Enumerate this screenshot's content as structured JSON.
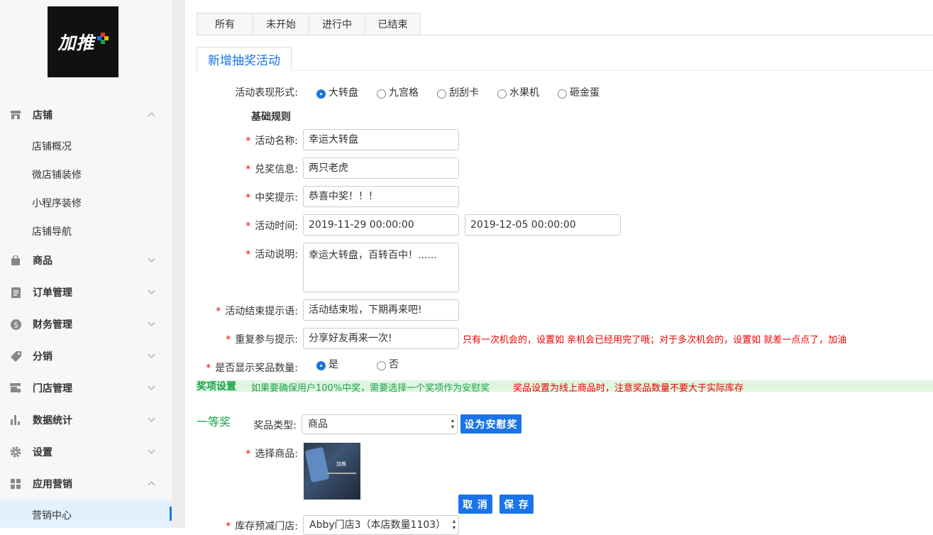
{
  "logo": {
    "text": "加推"
  },
  "sidebar": {
    "groups": [
      {
        "label": "店铺",
        "icon": "store-icon",
        "expanded": true,
        "items": [
          "店铺概况",
          "微店铺装修",
          "小程序装修",
          "店铺导航"
        ]
      },
      {
        "label": "商品",
        "icon": "bag-icon"
      },
      {
        "label": "订单管理",
        "icon": "order-icon"
      },
      {
        "label": "财务管理",
        "icon": "finance-icon"
      },
      {
        "label": "分销",
        "icon": "tag-icon"
      },
      {
        "label": "门店管理",
        "icon": "shop-settings-icon"
      },
      {
        "label": "数据统计",
        "icon": "bar-chart-icon"
      },
      {
        "label": "设置",
        "icon": "gear-icon"
      },
      {
        "label": "应用营销",
        "icon": "apps-icon",
        "expanded": true,
        "items": [
          "营销中心"
        ]
      }
    ],
    "active_item": "营销中心"
  },
  "tabs": [
    "所有",
    "未开始",
    "进行中",
    "已结束"
  ],
  "subtab": "新增抽奖活动",
  "form": {
    "style_label": "活动表现形式:",
    "styles": [
      "大转盘",
      "九宫格",
      "刮刮卡",
      "水果机",
      "砸金蛋"
    ],
    "style_selected": "大转盘",
    "section_basic": "基础规则",
    "name_label": "活动名称:",
    "name_value": "幸运大转盘",
    "prize_info_label": "兑奖信息:",
    "prize_info_value": "两只老虎",
    "win_tip_label": "中奖提示:",
    "win_tip_value": "恭喜中奖！！！",
    "time_label": "活动时间:",
    "time_start": "2019-11-29 00:00:00",
    "time_end": "2019-12-05 00:00:00",
    "desc_label": "活动说明:",
    "desc_value": "幸运大转盘，百转百中！......",
    "end_tip_label": "活动结束提示语:",
    "end_tip_value": "活动结束啦，下期再来吧!",
    "repeat_tip_label": "重复参与提示:",
    "repeat_tip_value": "分享好友再来一次!",
    "repeat_hint": "只有一次机会的，设置如 亲机会已经用完了哦；对于多次机会的，设置如 就差一点点了，加油",
    "show_count_label": "是否显示奖品数量:",
    "show_count_options": [
      "是",
      "否"
    ],
    "show_count_selected": "是"
  },
  "prize_settings": {
    "title": "奖项设置",
    "hint_green": "如果要确保用户100%中奖，需要选择一个奖项作为安慰奖",
    "hint_red": "奖品设置为线上商品时，注意奖品数量不要大于实际库存",
    "first_prize": "一等奖",
    "type_label": "奖品类型:",
    "type_value": "商品",
    "consolation_button": "设为安慰奖",
    "product_label": "选择商品:",
    "product_thumb_text": "加推",
    "cancel_button": "取 消",
    "save_button": "保 存",
    "store_label": "库存预减门店:",
    "store_value": "Abby门店3（本店数量1103）"
  },
  "colors": {
    "accent": "#1a73e8",
    "green": "#1aa34a",
    "red": "#e00000"
  }
}
